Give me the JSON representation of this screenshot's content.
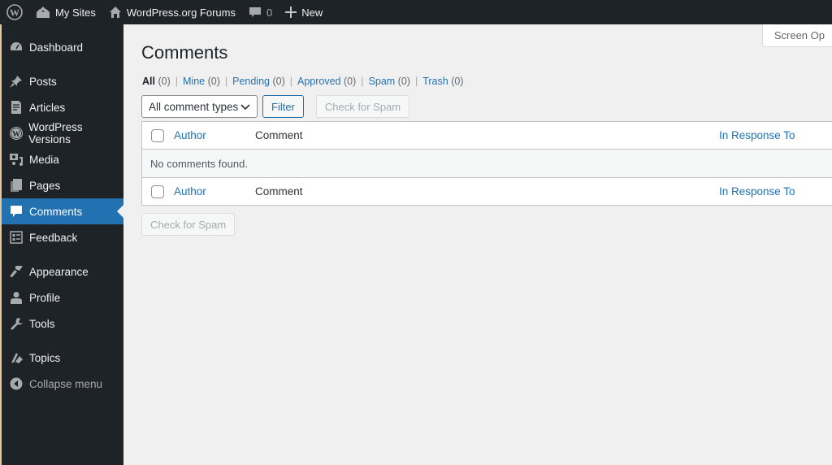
{
  "adminbar": {
    "my_sites": "My Sites",
    "site_name": "WordPress.org Forums",
    "comments_count": "0",
    "new_label": "New"
  },
  "sidebar": {
    "items": [
      {
        "label": "Dashboard",
        "icon": "dashboard-icon"
      },
      {
        "label": "Posts",
        "icon": "pin-icon"
      },
      {
        "label": "Articles",
        "icon": "document-icon"
      },
      {
        "label": "WordPress Versions",
        "icon": "wordpress-icon"
      },
      {
        "label": "Media",
        "icon": "media-icon"
      },
      {
        "label": "Pages",
        "icon": "pages-icon"
      },
      {
        "label": "Comments",
        "icon": "comment-icon",
        "active": true
      },
      {
        "label": "Feedback",
        "icon": "feedback-icon"
      },
      {
        "label": "Appearance",
        "icon": "brush-icon"
      },
      {
        "label": "Profile",
        "icon": "user-icon"
      },
      {
        "label": "Tools",
        "icon": "wrench-icon"
      },
      {
        "label": "Topics",
        "icon": "topics-icon"
      }
    ],
    "collapse_label": "Collapse menu"
  },
  "main": {
    "screen_options": "Screen Op",
    "title": "Comments",
    "filters": [
      {
        "label": "All",
        "count": "(0)",
        "current": true
      },
      {
        "label": "Mine",
        "count": "(0)"
      },
      {
        "label": "Pending",
        "count": "(0)"
      },
      {
        "label": "Approved",
        "count": "(0)"
      },
      {
        "label": "Spam",
        "count": "(0)"
      },
      {
        "label": "Trash",
        "count": "(0)"
      }
    ],
    "comment_type_select": "All comment types",
    "filter_button": "Filter",
    "check_spam_button": "Check for Spam",
    "table": {
      "columns": [
        "Author",
        "Comment",
        "In Response To"
      ],
      "empty_message": "No comments found."
    }
  },
  "colors": {
    "accent": "#2271b1",
    "adminbar": "#1d2327",
    "background": "#f0f0f1"
  }
}
